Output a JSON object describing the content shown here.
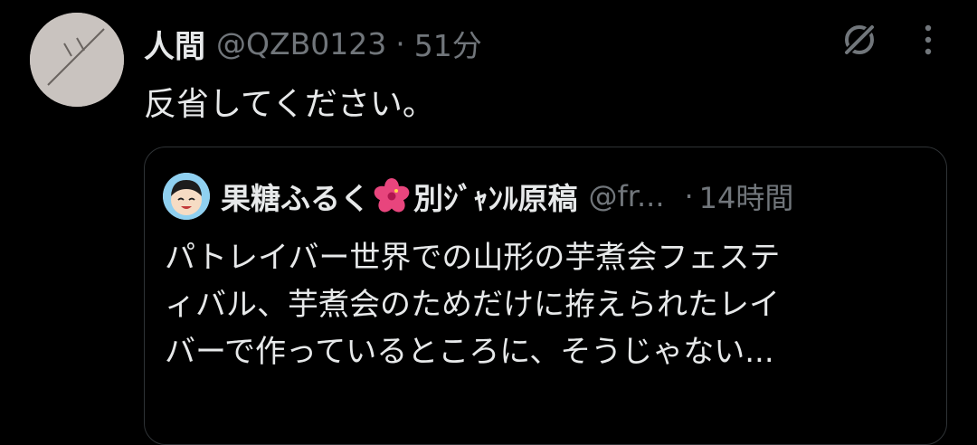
{
  "tweet": {
    "display_name": "人間",
    "handle": "@QZB0123",
    "separator": "·",
    "time": "51分",
    "text": "反省してください。"
  },
  "quote": {
    "display_name_part1": "果糖ふるく",
    "display_name_part2": "別ｼﾞｬﾝﾙ原稿",
    "handle": "@fr...",
    "separator": "·",
    "time": "14時間",
    "lines": [
      "パトレイバー世界での山形の芋煮会フェステ",
      "ィバル、芋煮会のためだけに拵えられたレイ",
      "バーで作っているところに、そうじゃない..."
    ]
  },
  "icons": {
    "avatar": "user-avatar",
    "grok": "grok-icon",
    "more": "more-vertical-icon",
    "hibiscus": "hibiscus-emoji-icon"
  },
  "colors": {
    "background": "#000000",
    "primary_text": "#e7e9ea",
    "secondary_text": "#71767b",
    "border": "#2f3336"
  }
}
